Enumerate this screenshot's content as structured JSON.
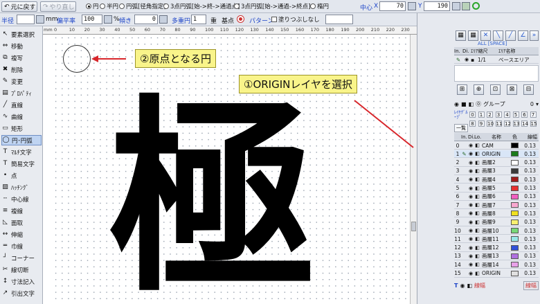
{
  "toolbar1": {
    "undo": "元に戻す",
    "redo": "やり直し",
    "radio_circle": "円",
    "radio_half": "半円",
    "radio_arc": "円弧[径角指定]",
    "radio_3pt": "3点円弧[始->終->通過点]",
    "radio_3pt2": "3点円弧[始->通過->終点]",
    "radio_ellipse": "楕円",
    "center_label": "中心",
    "x_label": "X",
    "y_label": "Y",
    "x_value": "70",
    "y_value": "190"
  },
  "toolbar2": {
    "radius_label": "半径",
    "mm_label": "mm",
    "flatness_label": "偏平率",
    "flatness_value": "100",
    "pct": "%",
    "tilt_label": "傾き",
    "tilt_value": "0",
    "multi_label": "多重円",
    "multi_value": "1",
    "multi_unit": "重",
    "base_label": "基点",
    "pattern_label": "パターン",
    "fill_label": "塗りつぶしなし"
  },
  "tools": [
    {
      "label": "要素選択",
      "icon": "arrow-icon"
    },
    {
      "label": "移動",
      "icon": "move-icon"
    },
    {
      "label": "複写",
      "icon": "copy-icon"
    },
    {
      "label": "削除",
      "icon": "delete-icon"
    },
    {
      "label": "変更",
      "icon": "edit-icon"
    },
    {
      "label": "ﾌﾟﾛﾊﾟﾃｨ",
      "icon": "property-icon"
    },
    {
      "label": "直線",
      "icon": "line-icon"
    },
    {
      "label": "曲線",
      "icon": "curve-icon"
    },
    {
      "label": "矩形",
      "icon": "rect-icon"
    },
    {
      "label": "円･円弧",
      "icon": "circle-icon"
    },
    {
      "label": "ﾏﾙﾁ文字",
      "icon": "multitext-icon"
    },
    {
      "label": "簡易文字",
      "icon": "text-icon"
    },
    {
      "label": "点",
      "icon": "point-icon"
    },
    {
      "label": "ﾊｯﾁﾝｸﾞ",
      "icon": "hatch-icon"
    },
    {
      "label": "中心線",
      "icon": "centerline-icon"
    },
    {
      "label": "複線",
      "icon": "multiline-icon"
    },
    {
      "label": "面取",
      "icon": "chamfer-icon"
    },
    {
      "label": "伸縮",
      "icon": "stretch-icon"
    },
    {
      "label": "巾線",
      "icon": "widthline-icon"
    },
    {
      "label": "コーナー",
      "icon": "corner-icon"
    },
    {
      "label": "線切断",
      "icon": "cut-icon"
    },
    {
      "label": "寸法記入",
      "icon": "dimension-icon"
    },
    {
      "label": "引出文字",
      "icon": "leader-icon"
    }
  ],
  "ruler": {
    "unit": "mm",
    "ticks": [
      "0",
      "10",
      "20",
      "30",
      "40",
      "50",
      "60",
      "70",
      "80",
      "90",
      "100",
      "110",
      "120",
      "130",
      "140",
      "150",
      "160",
      "170",
      "180",
      "190",
      "200",
      "210",
      "220",
      "230"
    ]
  },
  "annotations": {
    "origin_circle": "②原点となる円",
    "select_layer": "①ORIGINレイヤを選択"
  },
  "drawing_char": "極",
  "panel": {
    "all_space": "ALL [SPACE]",
    "scale_headers": [
      "In.",
      "Di.",
      "ｴﾘｱ縮尺",
      "ｴﾘｱ名称"
    ],
    "scale_row": {
      "scale": "1/1",
      "name": "ベースエリア"
    },
    "group_label": "グループ",
    "group_value": "0",
    "layer_group_label": "ﾚｲﾔｸﾞﾙｰﾌﾟ",
    "list_label": "一覧",
    "group_nums_top": [
      "0",
      "1",
      "2",
      "3",
      "4",
      "5",
      "6",
      "7"
    ],
    "group_nums_bottom": [
      "8",
      "9",
      "10",
      "11",
      "12",
      "13",
      "14",
      "15"
    ],
    "layer_headers": [
      "In.",
      "Di.",
      "Lo.",
      "名称",
      "色",
      "線幅"
    ],
    "layers": [
      {
        "num": "0",
        "name": "CAM",
        "color": "#000000",
        "width": "0.13"
      },
      {
        "num": "1",
        "name": "ORIGIN",
        "color": "#1a7a1a",
        "width": "0.13"
      },
      {
        "num": "2",
        "name": "画層2",
        "color": "#ffffff",
        "width": "0.13"
      },
      {
        "num": "3",
        "name": "画層3",
        "color": "#3a3a3a",
        "width": "0.13"
      },
      {
        "num": "4",
        "name": "画層4",
        "color": "#a01a1a",
        "width": "0.13"
      },
      {
        "num": "5",
        "name": "画層5",
        "color": "#e83030",
        "width": "0.13"
      },
      {
        "num": "6",
        "name": "画層6",
        "color": "#f060c0",
        "width": "0.13"
      },
      {
        "num": "7",
        "name": "画層7",
        "color": "#f8a8d0",
        "width": "0.13"
      },
      {
        "num": "8",
        "name": "画層8",
        "color": "#f0e020",
        "width": "0.13"
      },
      {
        "num": "9",
        "name": "画層9",
        "color": "#f8f070",
        "width": "0.13"
      },
      {
        "num": "10",
        "name": "画層10",
        "color": "#78d878",
        "width": "0.13"
      },
      {
        "num": "11",
        "name": "画層11",
        "color": "#98e8e8",
        "width": "0.13"
      },
      {
        "num": "12",
        "name": "画層12",
        "color": "#3050d8",
        "width": "0.13"
      },
      {
        "num": "13",
        "name": "画層13",
        "color": "#b070e0",
        "width": "0.13"
      },
      {
        "num": "14",
        "name": "画層14",
        "color": "#e8a0e8",
        "width": "0.13"
      },
      {
        "num": "15",
        "name": "ORIGIN",
        "color": "#e0e0e0",
        "width": "0.13"
      }
    ],
    "footer_text": "線幅",
    "footer_btn": "線幅"
  }
}
